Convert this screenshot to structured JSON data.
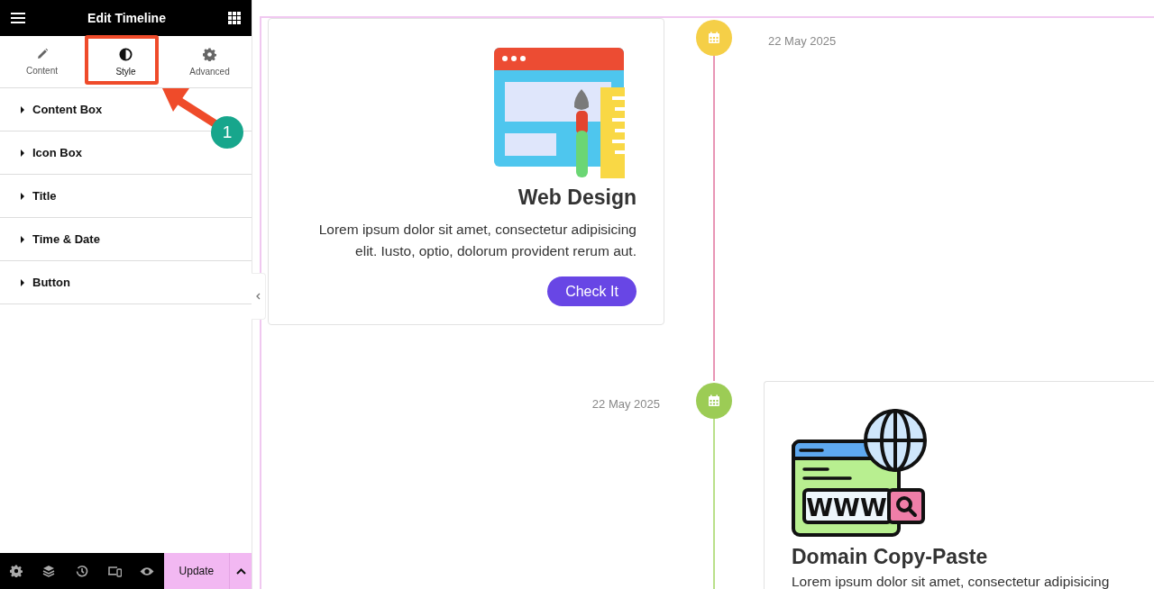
{
  "panel": {
    "title": "Edit Timeline",
    "tabs": [
      {
        "label": "Content",
        "kind": "pencil",
        "selected": false
      },
      {
        "label": "Style",
        "kind": "contrast",
        "selected": true
      },
      {
        "label": "Advanced",
        "kind": "gear",
        "selected": false
      }
    ],
    "sections": [
      {
        "label": "Content Box",
        "expanded": false
      },
      {
        "label": "Icon Box",
        "expanded": false
      },
      {
        "label": "Title",
        "expanded": false
      },
      {
        "label": "Time & Date",
        "expanded": false
      },
      {
        "label": "Button",
        "expanded": false
      }
    ],
    "footer": {
      "update_label": "Update"
    }
  },
  "annotation": {
    "step": "1"
  },
  "timeline": {
    "items": [
      {
        "date": "22 May 2025",
        "color": "#f5cf47",
        "title": "Web Design",
        "text": "Lorem ipsum dolor sit amet, consectetur adipisicing elit. Iusto, optio, dolorum provident rerum aut.",
        "button": "Check It"
      },
      {
        "date": "22 May 2025",
        "color": "#9ccc55",
        "icon_label": "WWW",
        "title": "Domain Copy-Paste",
        "text": "Lorem ipsum dolor sit amet, consectetur adipisicing"
      }
    ]
  }
}
